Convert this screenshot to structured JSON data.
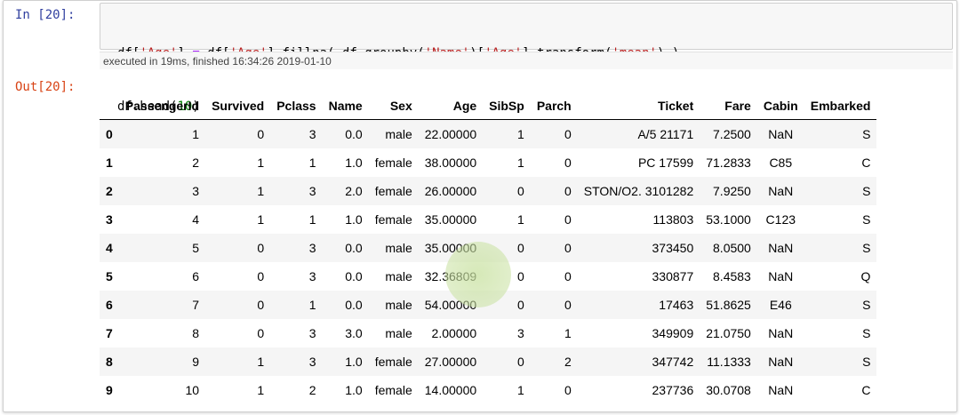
{
  "prompts": {
    "in": "In [20]:",
    "out": "Out[20]:"
  },
  "code": {
    "line1": [
      {
        "t": "df[",
        "c": ""
      },
      {
        "t": "'Age'",
        "c": "s"
      },
      {
        "t": "] ",
        "c": ""
      },
      {
        "t": "=",
        "c": "o"
      },
      {
        "t": " df[",
        "c": ""
      },
      {
        "t": "'Age'",
        "c": "s"
      },
      {
        "t": "].fillna( df.groupby(",
        "c": ""
      },
      {
        "t": "'Name'",
        "c": "s"
      },
      {
        "t": ")[",
        "c": ""
      },
      {
        "t": "'Age'",
        "c": "s"
      },
      {
        "t": "].transform(",
        "c": ""
      },
      {
        "t": "'mean'",
        "c": "s"
      },
      {
        "t": ") )",
        "c": ""
      }
    ],
    "line2": [
      {
        "t": "df.head(",
        "c": ""
      },
      {
        "t": "10",
        "c": "n"
      },
      {
        "t": ")",
        "c": ""
      }
    ]
  },
  "exec_info": "executed in 19ms, finished 16:34:26 2019-01-10",
  "table": {
    "columns": [
      "",
      "PassengerId",
      "Survived",
      "Pclass",
      "Name",
      "Sex",
      "Age",
      "SibSp",
      "Parch",
      "Ticket",
      "Fare",
      "Cabin",
      "Embarked"
    ],
    "rows": [
      [
        "0",
        "1",
        "0",
        "3",
        "0.0",
        "male",
        "22.00000",
        "1",
        "0",
        "A/5 21171",
        "7.2500",
        "NaN",
        "S"
      ],
      [
        "1",
        "2",
        "1",
        "1",
        "1.0",
        "female",
        "38.00000",
        "1",
        "0",
        "PC 17599",
        "71.2833",
        "C85",
        "C"
      ],
      [
        "2",
        "3",
        "1",
        "3",
        "2.0",
        "female",
        "26.00000",
        "0",
        "0",
        "STON/O2. 3101282",
        "7.9250",
        "NaN",
        "S"
      ],
      [
        "3",
        "4",
        "1",
        "1",
        "1.0",
        "female",
        "35.00000",
        "1",
        "0",
        "113803",
        "53.1000",
        "C123",
        "S"
      ],
      [
        "4",
        "5",
        "0",
        "3",
        "0.0",
        "male",
        "35.00000",
        "0",
        "0",
        "373450",
        "8.0500",
        "NaN",
        "S"
      ],
      [
        "5",
        "6",
        "0",
        "3",
        "0.0",
        "male",
        "32.36809",
        "0",
        "0",
        "330877",
        "8.4583",
        "NaN",
        "Q"
      ],
      [
        "6",
        "7",
        "0",
        "1",
        "0.0",
        "male",
        "54.00000",
        "0",
        "0",
        "17463",
        "51.8625",
        "E46",
        "S"
      ],
      [
        "7",
        "8",
        "0",
        "3",
        "3.0",
        "male",
        "2.00000",
        "3",
        "1",
        "349909",
        "21.0750",
        "NaN",
        "S"
      ],
      [
        "8",
        "9",
        "1",
        "3",
        "1.0",
        "female",
        "27.00000",
        "0",
        "2",
        "347742",
        "11.1333",
        "NaN",
        "S"
      ],
      [
        "9",
        "10",
        "1",
        "2",
        "1.0",
        "female",
        "14.00000",
        "1",
        "0",
        "237736",
        "30.0708",
        "NaN",
        "C"
      ]
    ]
  },
  "colors": {
    "in_prompt": "#303f9f",
    "out_prompt": "#d84315",
    "string": "#ba2121",
    "operator": "#aa22ff",
    "number": "#008000",
    "highlight": "#c8e1a0"
  }
}
